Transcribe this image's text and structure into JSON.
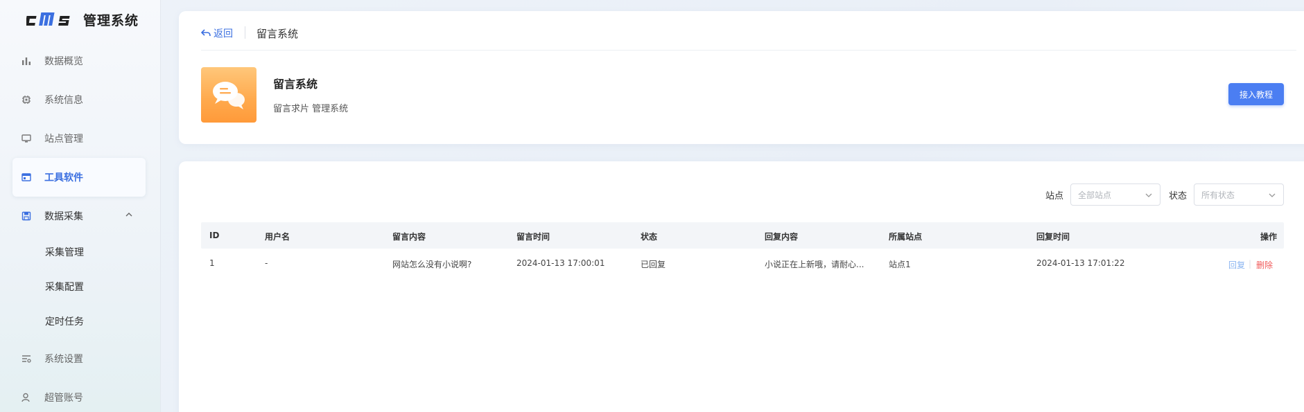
{
  "app": {
    "logo_text": "cms",
    "title": "管理系统"
  },
  "sidebar": {
    "items": [
      {
        "label": "数据概览",
        "icon": "bar-chart-icon"
      },
      {
        "label": "系统信息",
        "icon": "chip-icon"
      },
      {
        "label": "站点管理",
        "icon": "monitor-icon"
      },
      {
        "label": "工具软件",
        "icon": "window-icon",
        "active": true
      },
      {
        "label": "数据采集",
        "icon": "save-icon",
        "expanded": true
      },
      {
        "label": "采集管理"
      },
      {
        "label": "采集配置"
      },
      {
        "label": "定时任务"
      },
      {
        "label": "系统设置",
        "icon": "settings-sliders-icon"
      },
      {
        "label": "超管账号",
        "icon": "user-icon"
      }
    ]
  },
  "header": {
    "back_label": "返回",
    "breadcrumb": "留言系统",
    "app_name": "留言系统",
    "app_desc": "留言求片 管理系统",
    "tutorial_button": "接入教程"
  },
  "filters": {
    "site_label": "站点",
    "site_placeholder": "全部站点",
    "status_label": "状态",
    "status_placeholder": "所有状态"
  },
  "table": {
    "columns": [
      "ID",
      "用户名",
      "留言内容",
      "留言时间",
      "状态",
      "回复内容",
      "所属站点",
      "回复时间",
      "操作"
    ],
    "rows": [
      {
        "id": "1",
        "username": "-",
        "content": "网站怎么没有小说啊?",
        "time": "2024-01-13 17:00:01",
        "status": "已回复",
        "reply": "小说正在上新哦，请耐心...",
        "site": "站点1",
        "reply_time": "2024-01-13 17:01:22",
        "actions": {
          "reply": "回复",
          "sep": "|",
          "delete": "删除"
        }
      }
    ]
  },
  "colors": {
    "accent": "#4b7ef2",
    "danger": "#f05a5a",
    "app_icon": "#ffa94c"
  }
}
